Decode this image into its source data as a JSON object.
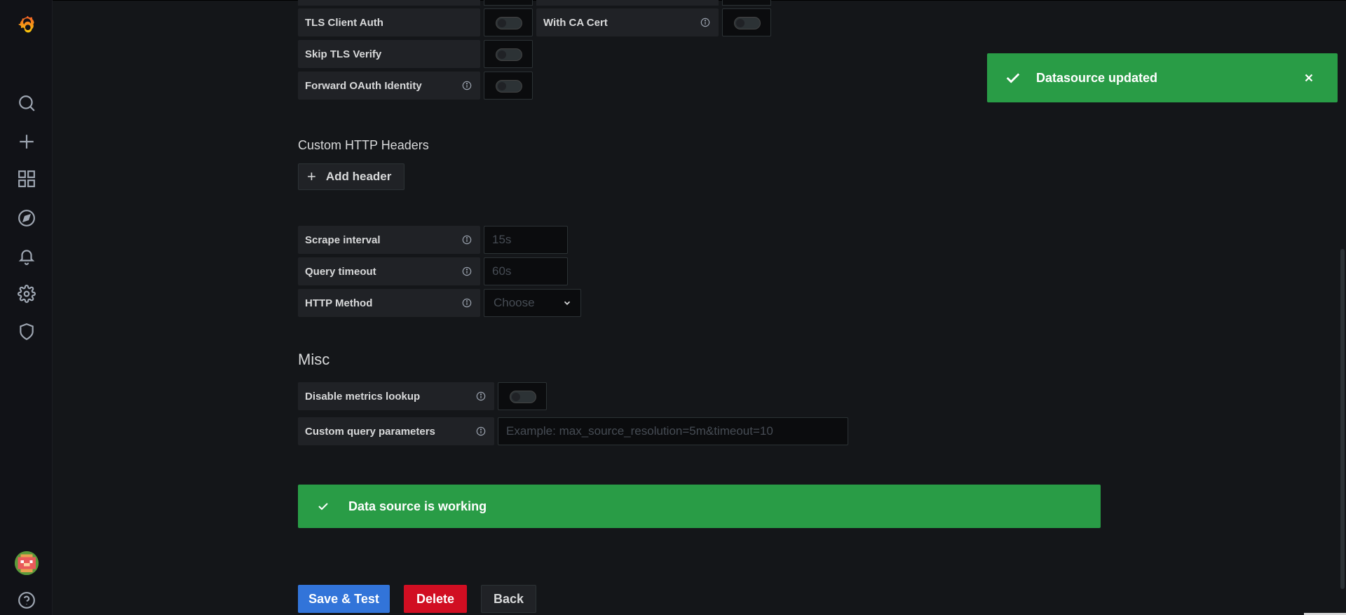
{
  "toggles": {
    "tls_client_auth": "TLS Client Auth",
    "with_ca_cert": "With CA Cert",
    "skip_tls_verify": "Skip TLS Verify",
    "forward_oauth": "Forward OAuth Identity"
  },
  "custom_headers": {
    "title": "Custom HTTP Headers",
    "add_label": "Add header"
  },
  "settings": {
    "scrape_interval_label": "Scrape interval",
    "scrape_interval_placeholder": "15s",
    "query_timeout_label": "Query timeout",
    "query_timeout_placeholder": "60s",
    "http_method_label": "HTTP Method",
    "http_method_value": "Choose"
  },
  "misc": {
    "title": "Misc",
    "disable_metrics_label": "Disable metrics lookup",
    "custom_query_label": "Custom query parameters",
    "custom_query_placeholder": "Example: max_source_resolution=5m&timeout=10"
  },
  "status": {
    "working": "Data source is working"
  },
  "buttons": {
    "save_test": "Save & Test",
    "delete": "Delete",
    "back": "Back"
  },
  "toast": {
    "message": "Datasource updated"
  },
  "colors": {
    "success": "#299c46",
    "primary": "#3274d9",
    "danger": "#d10e22",
    "background": "#141619"
  },
  "icons": {
    "sidebar": [
      "grafana-logo-icon",
      "search-icon",
      "plus-icon",
      "dashboards-icon",
      "explore-icon",
      "alerting-bell-icon",
      "gear-icon",
      "shield-icon",
      "avatar",
      "help-icon"
    ]
  }
}
